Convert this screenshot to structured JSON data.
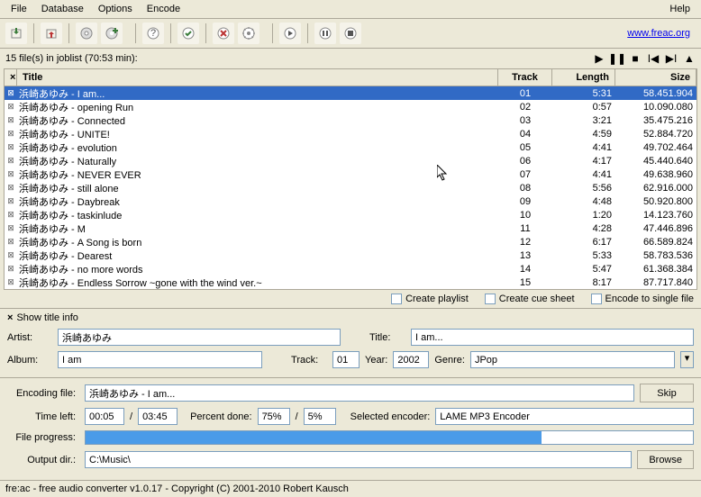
{
  "menu": {
    "file": "File",
    "database": "Database",
    "options": "Options",
    "encode": "Encode",
    "help": "Help"
  },
  "toolbar_link": "www.freac.org",
  "joblist": {
    "status": "15 file(s) in joblist (70:53 min):"
  },
  "table": {
    "headers": {
      "title": "Title",
      "track": "Track",
      "length": "Length",
      "size": "Size"
    },
    "rows": [
      {
        "title": "浜崎あゆみ - I am...",
        "track": "01",
        "length": "5:31",
        "size": "58.451.904",
        "selected": true
      },
      {
        "title": "浜崎あゆみ - opening Run",
        "track": "02",
        "length": "0:57",
        "size": "10.090.080"
      },
      {
        "title": "浜崎あゆみ - Connected",
        "track": "03",
        "length": "3:21",
        "size": "35.475.216"
      },
      {
        "title": "浜崎あゆみ - UNITE!",
        "track": "04",
        "length": "4:59",
        "size": "52.884.720"
      },
      {
        "title": "浜崎あゆみ - evolution",
        "track": "05",
        "length": "4:41",
        "size": "49.702.464"
      },
      {
        "title": "浜崎あゆみ - Naturally",
        "track": "06",
        "length": "4:17",
        "size": "45.440.640"
      },
      {
        "title": "浜崎あゆみ - NEVER EVER",
        "track": "07",
        "length": "4:41",
        "size": "49.638.960"
      },
      {
        "title": "浜崎あゆみ - still alone",
        "track": "08",
        "length": "5:56",
        "size": "62.916.000"
      },
      {
        "title": "浜崎あゆみ - Daybreak",
        "track": "09",
        "length": "4:48",
        "size": "50.920.800"
      },
      {
        "title": "浜崎あゆみ - taskinlude",
        "track": "10",
        "length": "1:20",
        "size": "14.123.760"
      },
      {
        "title": "浜崎あゆみ - M",
        "track": "11",
        "length": "4:28",
        "size": "47.446.896"
      },
      {
        "title": "浜崎あゆみ - A Song is born",
        "track": "12",
        "length": "6:17",
        "size": "66.589.824"
      },
      {
        "title": "浜崎あゆみ - Dearest",
        "track": "13",
        "length": "5:33",
        "size": "58.783.536"
      },
      {
        "title": "浜崎あゆみ - no more words",
        "track": "14",
        "length": "5:47",
        "size": "61.368.384"
      },
      {
        "title": "浜崎あゆみ - Endless Sorrow ~gone with the wind ver.~",
        "track": "15",
        "length": "8:17",
        "size": "87.717.840"
      }
    ]
  },
  "options": {
    "playlist": "Create playlist",
    "cuesheet": "Create cue sheet",
    "singlefile": "Encode to single file"
  },
  "titleinfo": {
    "header": "Show title info",
    "artist_label": "Artist:",
    "artist": "浜崎あゆみ",
    "album_label": "Album:",
    "album": "I am",
    "title_label": "Title:",
    "title_value": "I am...",
    "track_label": "Track:",
    "track": "01",
    "year_label": "Year:",
    "year": "2002",
    "genre_label": "Genre:",
    "genre": "JPop"
  },
  "encoding": {
    "file_label": "Encoding file:",
    "file": "浜崎あゆみ - I am...",
    "skip": "Skip",
    "timeleft_label": "Time left:",
    "elapsed": "00:05",
    "total": "03:45",
    "percent_label": "Percent done:",
    "percent1": "75%",
    "percent2": "5%",
    "selenc_label": "Selected encoder:",
    "encoder": "LAME MP3 Encoder",
    "progress_label": "File progress:",
    "progress_pct": 75,
    "output_label": "Output dir.:",
    "output": "C:\\Music\\",
    "browse": "Browse",
    "slash": "/"
  },
  "status": "fre:ac - free audio converter v1.0.17 - Copyright (C) 2001-2010 Robert Kausch"
}
